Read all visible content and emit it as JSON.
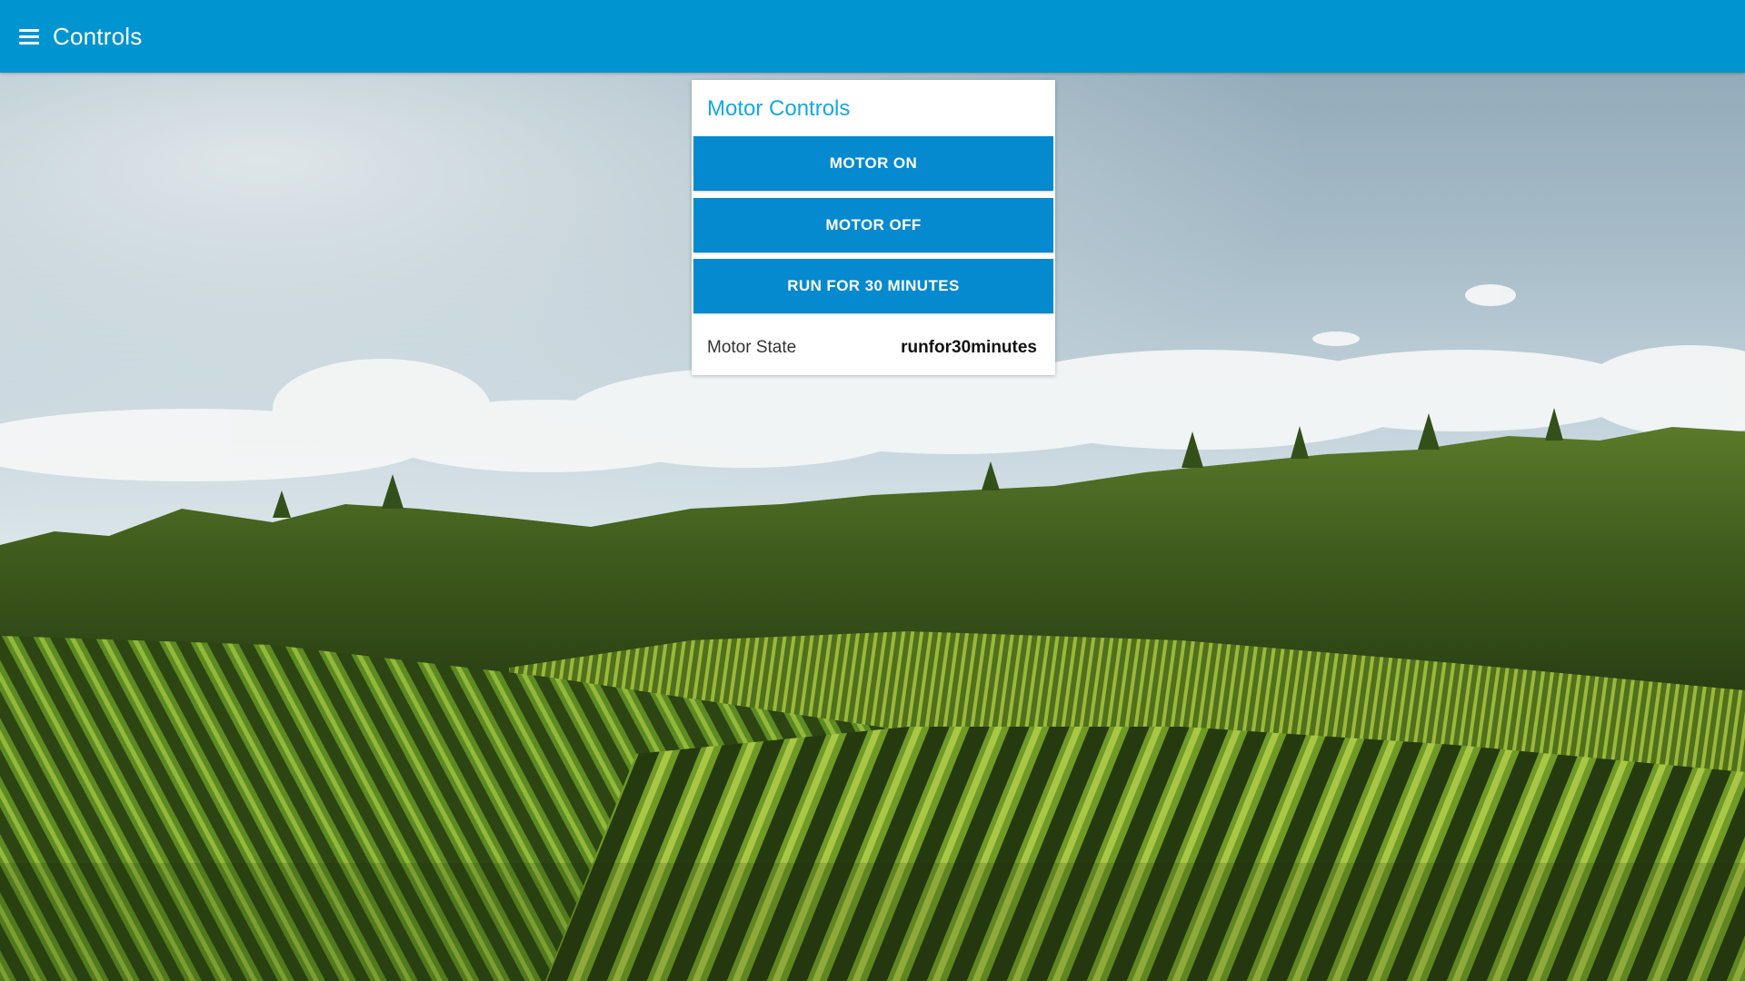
{
  "header": {
    "title": "Controls",
    "menu_icon": "hamburger-menu-icon",
    "background_color": "#0094d0"
  },
  "card": {
    "title": "Motor Controls",
    "title_color": "#14a8e6",
    "buttons": [
      {
        "label": "MOTOR ON"
      },
      {
        "label": "MOTOR OFF"
      },
      {
        "label": "RUN FOR 30 MINUTES"
      }
    ],
    "button_color": "#0589cf",
    "state": {
      "label": "Motor State",
      "value": "runfor30minutes"
    }
  }
}
